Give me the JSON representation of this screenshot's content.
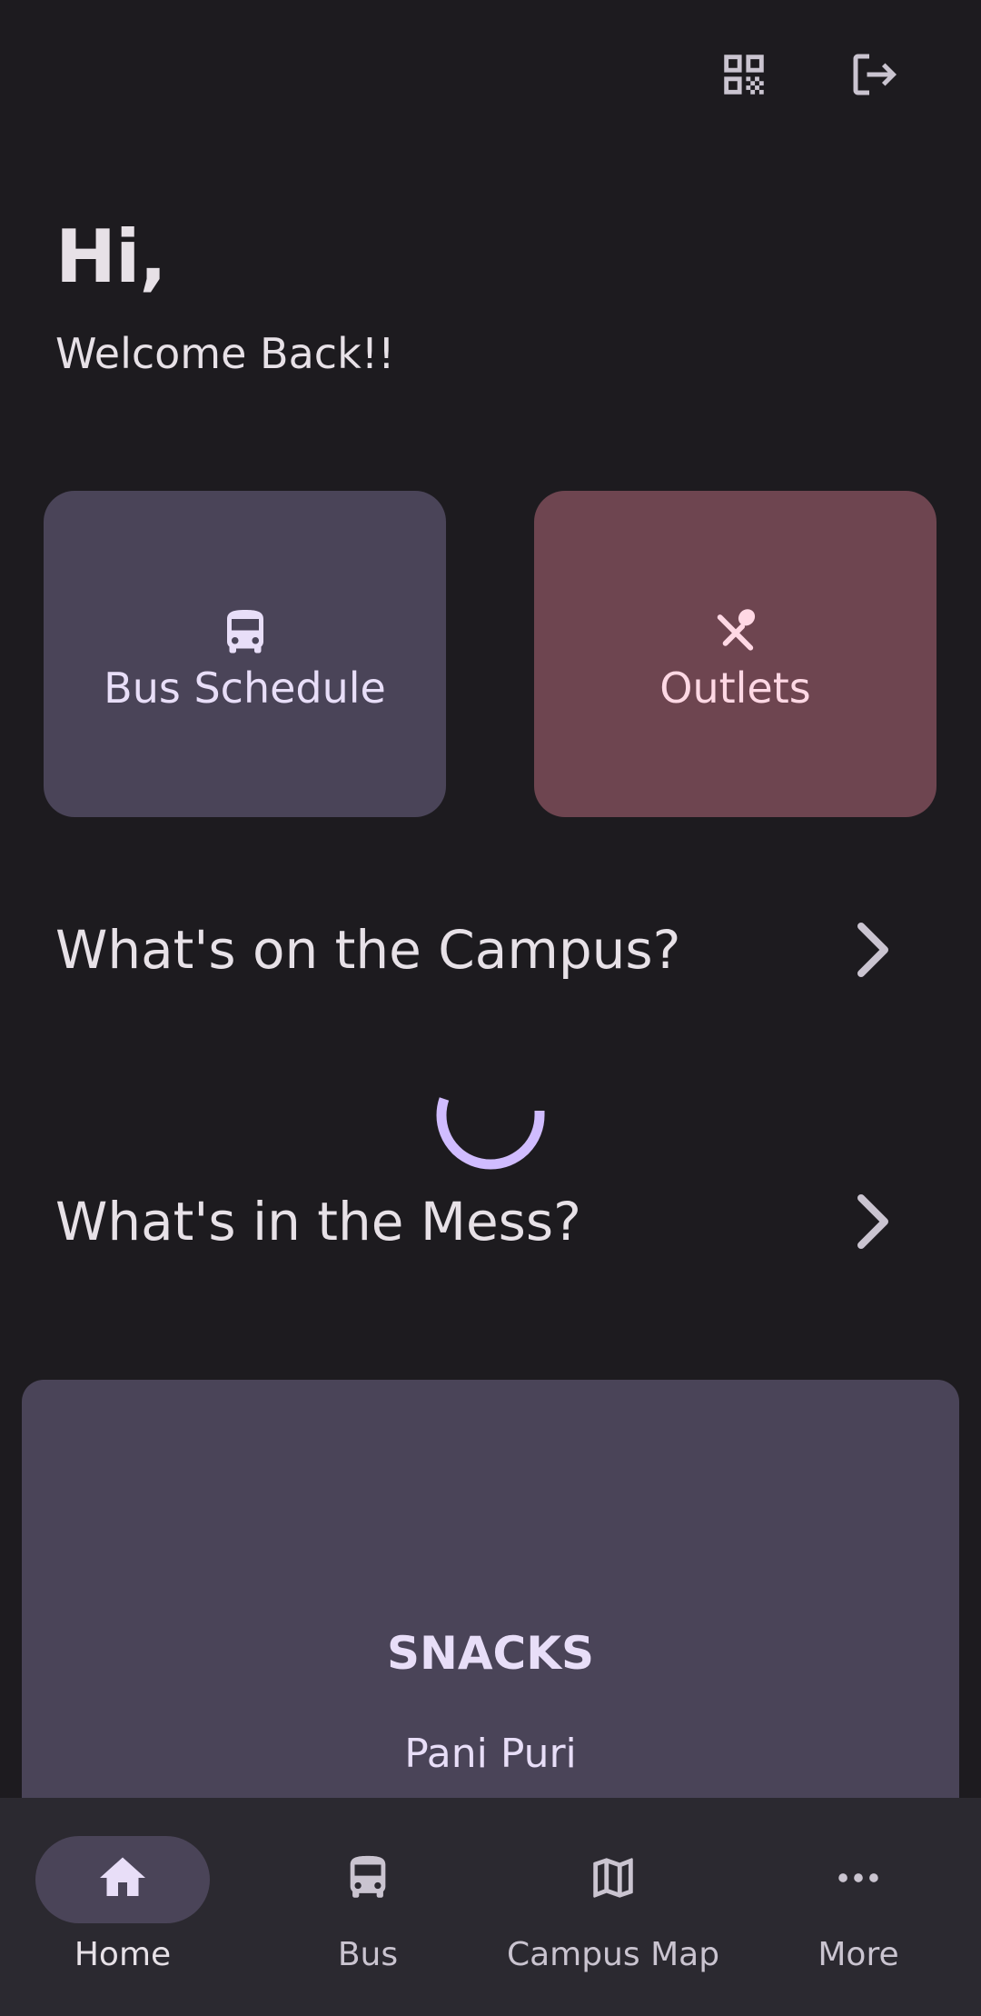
{
  "top_bar": {
    "qr_icon": "qr-code-icon",
    "logout_icon": "logout-icon"
  },
  "greeting": {
    "title": "Hi,",
    "subtitle": "Welcome Back!!"
  },
  "quick_tiles": [
    {
      "label": "Bus Schedule",
      "icon": "bus-icon",
      "color": "#4a4458",
      "text_color": "#e8def8"
    },
    {
      "label": "Outlets",
      "icon": "restaurant-icon",
      "color": "#6e4550",
      "text_color": "#ffd8e4"
    }
  ],
  "sections": {
    "campus": {
      "title": "What's on the Campus?"
    },
    "mess": {
      "title": "What's in the Mess?"
    }
  },
  "loading": {
    "color": "#d0bcff"
  },
  "mess_card": {
    "category": "SNACKS",
    "item": "Pani Puri"
  },
  "bottom_nav": {
    "items": [
      {
        "label": "Home",
        "icon": "home-icon",
        "active": true
      },
      {
        "label": "Bus",
        "icon": "bus-icon",
        "active": false
      },
      {
        "label": "Campus Map",
        "icon": "map-icon",
        "active": false
      },
      {
        "label": "More",
        "icon": "more-horizontal-icon",
        "active": false
      }
    ]
  },
  "colors": {
    "background": "#1d1b1f",
    "surface": "#2b2930",
    "on_surface": "#e7e1e7",
    "primary_container": "#4a4458",
    "tertiary_container": "#6e4550",
    "primary": "#d0bcff"
  }
}
